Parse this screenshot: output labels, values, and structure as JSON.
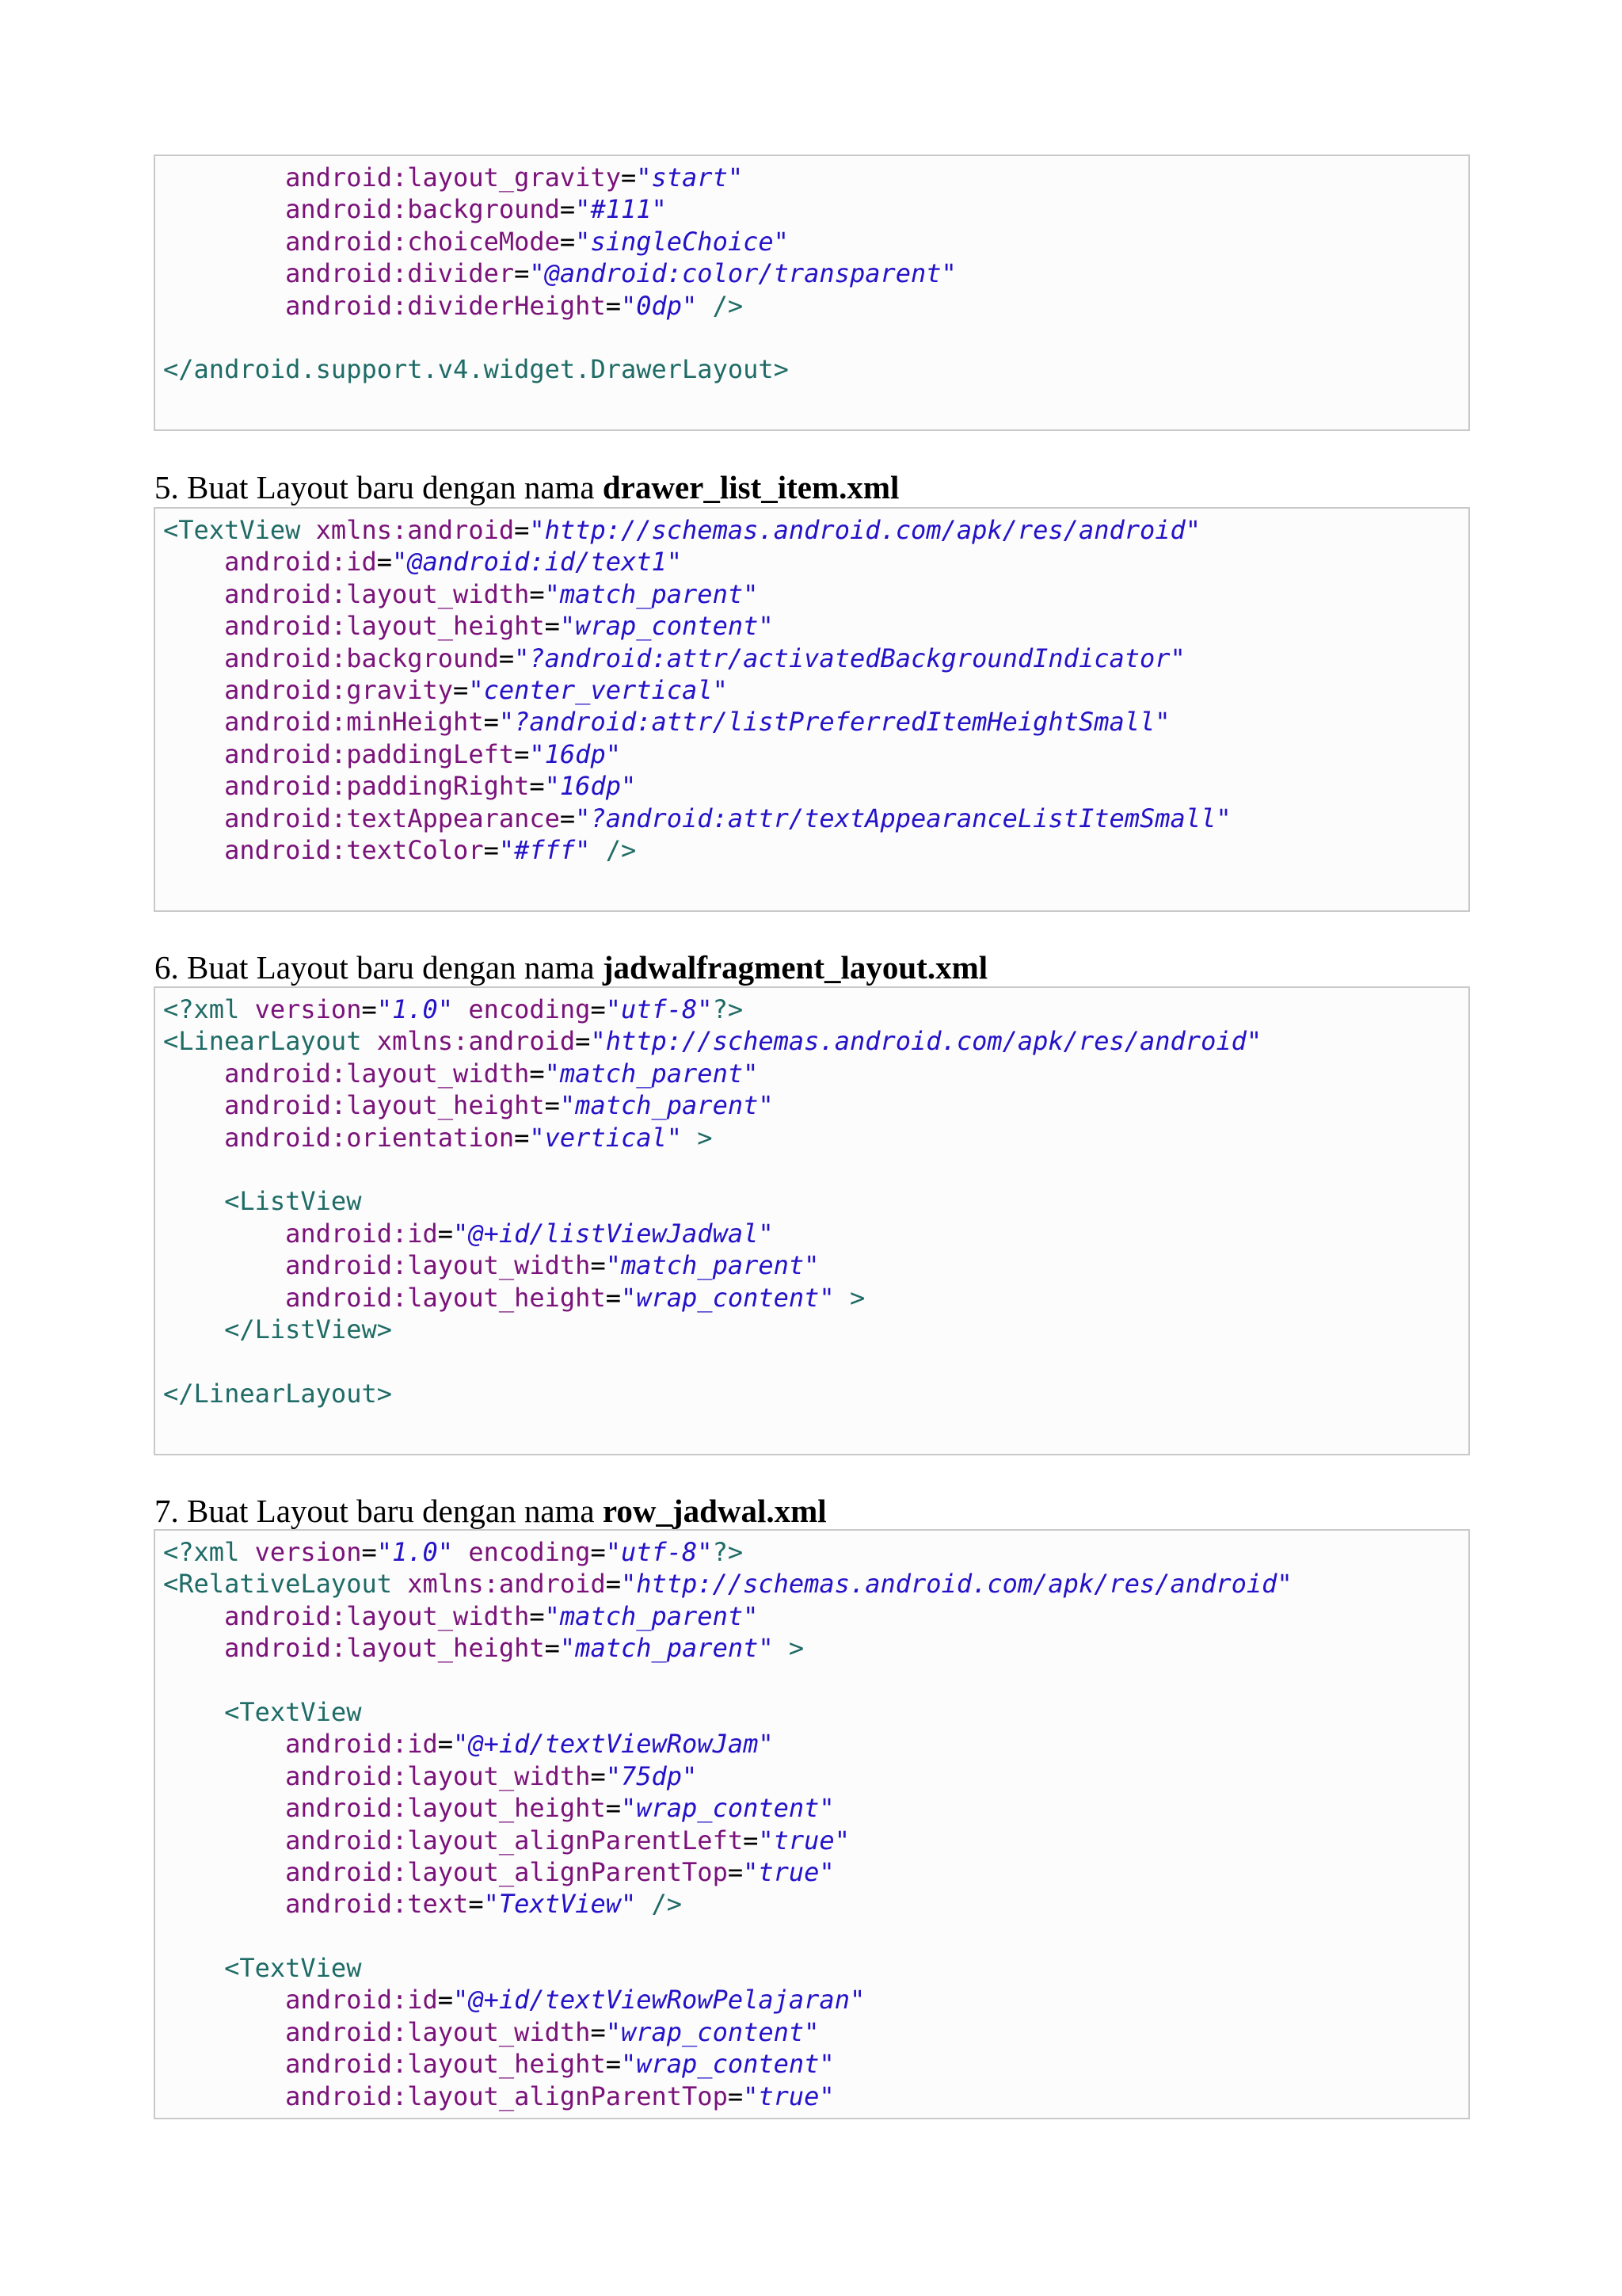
{
  "blocks": [
    {
      "heading": null,
      "lines": [
        [
          [
            "        ",
            "eq"
          ],
          [
            "android:layout_gravity",
            "attr"
          ],
          [
            "=",
            "eq"
          ],
          [
            "\"start\"",
            "val"
          ]
        ],
        [
          [
            "        ",
            "eq"
          ],
          [
            "android:background",
            "attr"
          ],
          [
            "=",
            "eq"
          ],
          [
            "\"#111\"",
            "val"
          ]
        ],
        [
          [
            "        ",
            "eq"
          ],
          [
            "android:choiceMode",
            "attr"
          ],
          [
            "=",
            "eq"
          ],
          [
            "\"singleChoice\"",
            "val"
          ]
        ],
        [
          [
            "        ",
            "eq"
          ],
          [
            "android:divider",
            "attr"
          ],
          [
            "=",
            "eq"
          ],
          [
            "\"@android:color/transparent\"",
            "val"
          ]
        ],
        [
          [
            "        ",
            "eq"
          ],
          [
            "android:dividerHeight",
            "attr"
          ],
          [
            "=",
            "eq"
          ],
          [
            "\"0dp\"",
            "val"
          ],
          [
            " />",
            "tag"
          ]
        ],
        [],
        [
          [
            "</android.support.v4.widget.DrawerLayout>",
            "tag"
          ]
        ]
      ]
    },
    {
      "heading": {
        "prefix": "5. Buat Layout baru dengan nama ",
        "name": "drawer_list_item.xml"
      },
      "lines": [
        [
          [
            "<TextView ",
            "tag"
          ],
          [
            "xmlns:android",
            "attr"
          ],
          [
            "=",
            "eq"
          ],
          [
            "\"http://schemas.android.com/apk/res/android\"",
            "val"
          ]
        ],
        [
          [
            "    ",
            "eq"
          ],
          [
            "android:id",
            "attr"
          ],
          [
            "=",
            "eq"
          ],
          [
            "\"@android:id/text1\"",
            "val"
          ]
        ],
        [
          [
            "    ",
            "eq"
          ],
          [
            "android:layout_width",
            "attr"
          ],
          [
            "=",
            "eq"
          ],
          [
            "\"match_parent\"",
            "val"
          ]
        ],
        [
          [
            "    ",
            "eq"
          ],
          [
            "android:layout_height",
            "attr"
          ],
          [
            "=",
            "eq"
          ],
          [
            "\"wrap_content\"",
            "val"
          ]
        ],
        [
          [
            "    ",
            "eq"
          ],
          [
            "android:background",
            "attr"
          ],
          [
            "=",
            "eq"
          ],
          [
            "\"?android:attr/activatedBackgroundIndicator\"",
            "val"
          ]
        ],
        [
          [
            "    ",
            "eq"
          ],
          [
            "android:gravity",
            "attr"
          ],
          [
            "=",
            "eq"
          ],
          [
            "\"center_vertical\"",
            "val"
          ]
        ],
        [
          [
            "    ",
            "eq"
          ],
          [
            "android:minHeight",
            "attr"
          ],
          [
            "=",
            "eq"
          ],
          [
            "\"?android:attr/listPreferredItemHeightSmall\"",
            "val"
          ]
        ],
        [
          [
            "    ",
            "eq"
          ],
          [
            "android:paddingLeft",
            "attr"
          ],
          [
            "=",
            "eq"
          ],
          [
            "\"16dp\"",
            "val"
          ]
        ],
        [
          [
            "    ",
            "eq"
          ],
          [
            "android:paddingRight",
            "attr"
          ],
          [
            "=",
            "eq"
          ],
          [
            "\"16dp\"",
            "val"
          ]
        ],
        [
          [
            "    ",
            "eq"
          ],
          [
            "android:textAppearance",
            "attr"
          ],
          [
            "=",
            "eq"
          ],
          [
            "\"?android:attr/textAppearanceListItemSmall\"",
            "val"
          ]
        ],
        [
          [
            "    ",
            "eq"
          ],
          [
            "android:textColor",
            "attr"
          ],
          [
            "=",
            "eq"
          ],
          [
            "\"#fff\"",
            "val"
          ],
          [
            " />",
            "tag"
          ]
        ]
      ]
    },
    {
      "heading": {
        "prefix": "6. Buat Layout baru dengan nama ",
        "name": "jadwalfragment_layout.xml"
      },
      "lines": [
        [
          [
            "<?xml ",
            "tag"
          ],
          [
            "version",
            "attr"
          ],
          [
            "=",
            "eq"
          ],
          [
            "\"1.0\"",
            "val"
          ],
          [
            " ",
            "eq"
          ],
          [
            "encoding",
            "attr"
          ],
          [
            "=",
            "eq"
          ],
          [
            "\"utf-8\"",
            "val"
          ],
          [
            "?>",
            "tag"
          ]
        ],
        [
          [
            "<LinearLayout ",
            "tag"
          ],
          [
            "xmlns:android",
            "attr"
          ],
          [
            "=",
            "eq"
          ],
          [
            "\"http://schemas.android.com/apk/res/android\"",
            "val"
          ]
        ],
        [
          [
            "    ",
            "eq"
          ],
          [
            "android:layout_width",
            "attr"
          ],
          [
            "=",
            "eq"
          ],
          [
            "\"match_parent\"",
            "val"
          ]
        ],
        [
          [
            "    ",
            "eq"
          ],
          [
            "android:layout_height",
            "attr"
          ],
          [
            "=",
            "eq"
          ],
          [
            "\"match_parent\"",
            "val"
          ]
        ],
        [
          [
            "    ",
            "eq"
          ],
          [
            "android:orientation",
            "attr"
          ],
          [
            "=",
            "eq"
          ],
          [
            "\"vertical\"",
            "val"
          ],
          [
            " >",
            "tag"
          ]
        ],
        [],
        [
          [
            "    ",
            "eq"
          ],
          [
            "<ListView",
            "tag"
          ]
        ],
        [
          [
            "        ",
            "eq"
          ],
          [
            "android:id",
            "attr"
          ],
          [
            "=",
            "eq"
          ],
          [
            "\"@+id/listViewJadwal\"",
            "val"
          ]
        ],
        [
          [
            "        ",
            "eq"
          ],
          [
            "android:layout_width",
            "attr"
          ],
          [
            "=",
            "eq"
          ],
          [
            "\"match_parent\"",
            "val"
          ]
        ],
        [
          [
            "        ",
            "eq"
          ],
          [
            "android:layout_height",
            "attr"
          ],
          [
            "=",
            "eq"
          ],
          [
            "\"wrap_content\"",
            "val"
          ],
          [
            " >",
            "tag"
          ]
        ],
        [
          [
            "    ",
            "eq"
          ],
          [
            "</ListView>",
            "tag"
          ]
        ],
        [],
        [
          [
            "</LinearLayout>",
            "tag"
          ]
        ]
      ]
    },
    {
      "heading": {
        "prefix": "7. Buat Layout baru dengan nama ",
        "name": "row_jadwal.xml"
      },
      "lines": [
        [
          [
            "<?xml ",
            "tag"
          ],
          [
            "version",
            "attr"
          ],
          [
            "=",
            "eq"
          ],
          [
            "\"1.0\"",
            "val"
          ],
          [
            " ",
            "eq"
          ],
          [
            "encoding",
            "attr"
          ],
          [
            "=",
            "eq"
          ],
          [
            "\"utf-8\"",
            "val"
          ],
          [
            "?>",
            "tag"
          ]
        ],
        [
          [
            "<RelativeLayout ",
            "tag"
          ],
          [
            "xmlns:android",
            "attr"
          ],
          [
            "=",
            "eq"
          ],
          [
            "\"http://schemas.android.com/apk/res/android\"",
            "val"
          ]
        ],
        [
          [
            "    ",
            "eq"
          ],
          [
            "android:layout_width",
            "attr"
          ],
          [
            "=",
            "eq"
          ],
          [
            "\"match_parent\"",
            "val"
          ]
        ],
        [
          [
            "    ",
            "eq"
          ],
          [
            "android:layout_height",
            "attr"
          ],
          [
            "=",
            "eq"
          ],
          [
            "\"match_parent\"",
            "val"
          ],
          [
            " >",
            "tag"
          ]
        ],
        [],
        [
          [
            "    ",
            "eq"
          ],
          [
            "<TextView",
            "tag"
          ]
        ],
        [
          [
            "        ",
            "eq"
          ],
          [
            "android:id",
            "attr"
          ],
          [
            "=",
            "eq"
          ],
          [
            "\"@+id/textViewRowJam\"",
            "val"
          ]
        ],
        [
          [
            "        ",
            "eq"
          ],
          [
            "android:layout_width",
            "attr"
          ],
          [
            "=",
            "eq"
          ],
          [
            "\"75dp\"",
            "val"
          ]
        ],
        [
          [
            "        ",
            "eq"
          ],
          [
            "android:layout_height",
            "attr"
          ],
          [
            "=",
            "eq"
          ],
          [
            "\"wrap_content\"",
            "val"
          ]
        ],
        [
          [
            "        ",
            "eq"
          ],
          [
            "android:layout_alignParentLeft",
            "attr"
          ],
          [
            "=",
            "eq"
          ],
          [
            "\"true\"",
            "val"
          ]
        ],
        [
          [
            "        ",
            "eq"
          ],
          [
            "android:layout_alignParentTop",
            "attr"
          ],
          [
            "=",
            "eq"
          ],
          [
            "\"true\"",
            "val"
          ]
        ],
        [
          [
            "        ",
            "eq"
          ],
          [
            "android:text",
            "attr"
          ],
          [
            "=",
            "eq"
          ],
          [
            "\"TextView\"",
            "val"
          ],
          [
            " />",
            "tag"
          ]
        ],
        [],
        [
          [
            "    ",
            "eq"
          ],
          [
            "<TextView",
            "tag"
          ]
        ],
        [
          [
            "        ",
            "eq"
          ],
          [
            "android:id",
            "attr"
          ],
          [
            "=",
            "eq"
          ],
          [
            "\"@+id/textViewRowPelajaran\"",
            "val"
          ]
        ],
        [
          [
            "        ",
            "eq"
          ],
          [
            "android:layout_width",
            "attr"
          ],
          [
            "=",
            "eq"
          ],
          [
            "\"wrap_content\"",
            "val"
          ]
        ],
        [
          [
            "        ",
            "eq"
          ],
          [
            "android:layout_height",
            "attr"
          ],
          [
            "=",
            "eq"
          ],
          [
            "\"wrap_content\"",
            "val"
          ]
        ],
        [
          [
            "        ",
            "eq"
          ],
          [
            "android:layout_alignParentTop",
            "attr"
          ],
          [
            "=",
            "eq"
          ],
          [
            "\"true\"",
            "val"
          ]
        ]
      ]
    }
  ]
}
